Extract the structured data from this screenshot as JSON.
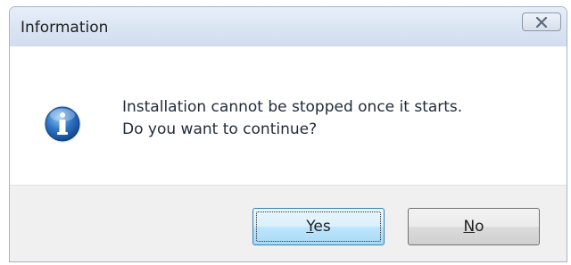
{
  "dialog": {
    "title": "Information",
    "message_line1": "Installation cannot be stopped once it starts.",
    "message_line2": "Do you want to continue?",
    "icon": "information-icon",
    "close_icon": "close-icon"
  },
  "buttons": {
    "yes": {
      "mnemonic": "Y",
      "rest": "es"
    },
    "no": {
      "mnemonic": "N",
      "rest": "o"
    }
  },
  "colors": {
    "title_bar": "#dae5f3",
    "footer": "#f0f0f0",
    "default_button_border": "#3c7fb1",
    "icon_blue": "#1d5fae"
  }
}
